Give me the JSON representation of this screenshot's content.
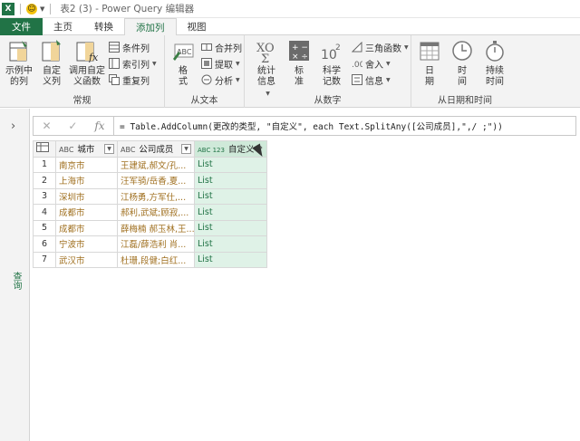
{
  "window": {
    "app_icon": "excel-icon",
    "title": "表2 (3) - Power Query 编辑器"
  },
  "tabs": [
    {
      "label": "文件"
    },
    {
      "label": "主页"
    },
    {
      "label": "转换"
    },
    {
      "label": "添加列"
    },
    {
      "label": "视图"
    }
  ],
  "ribbon": {
    "general": {
      "label": "常规",
      "example_col": "示例中\n的列",
      "custom_col": "自定\n义列",
      "invoke_fn": "调用自定\n义函数",
      "conditional": "条件列",
      "index": "索引列",
      "duplicate": "重复列"
    },
    "text": {
      "label": "从文本",
      "format": "格\n式",
      "merge": "合并列",
      "extract": "提取",
      "parse": "分析"
    },
    "number": {
      "label": "从数字",
      "stats": "统计\n信息",
      "standard": "标\n准",
      "scientific": "科学\n记数",
      "trig": "三角函数",
      "rounding": "舍入",
      "info": "信息"
    },
    "datetime": {
      "label": "从日期和时间",
      "date": "日\n期",
      "time": "时\n间",
      "duration": "持续\n时间"
    }
  },
  "left_pane": {
    "label": "查询"
  },
  "formula": {
    "text": "= Table.AddColumn(更改的类型, \"自定义\", each Text.SplitAny([公司成员],\",/ ;\"))"
  },
  "table": {
    "columns": [
      {
        "type": "ABC",
        "name": "城市"
      },
      {
        "type": "ABC",
        "name": "公司成员"
      },
      {
        "type": "ABC 123",
        "name": "自定义"
      }
    ],
    "rows": [
      {
        "n": "1",
        "city": "南京市",
        "emp": "王建斌,郝文/孔...",
        "custom": "List"
      },
      {
        "n": "2",
        "city": "上海市",
        "emp": "汪军骑/岳香,夏...",
        "custom": "List"
      },
      {
        "n": "3",
        "city": "深圳市",
        "emp": "江杨勇,方军仕,...",
        "custom": "List"
      },
      {
        "n": "4",
        "city": "成都市",
        "emp": "郝利,武斌;顾寂,...",
        "custom": "List"
      },
      {
        "n": "5",
        "city": "成都市",
        "emp": "薛梅楠 郝玉林,王...",
        "custom": "List"
      },
      {
        "n": "6",
        "city": "宁波市",
        "emp": "江磊/薛浩利 肖...",
        "custom": "List"
      },
      {
        "n": "7",
        "city": "武汉市",
        "emp": "杜珊,段健;白红...",
        "custom": "List"
      }
    ]
  }
}
